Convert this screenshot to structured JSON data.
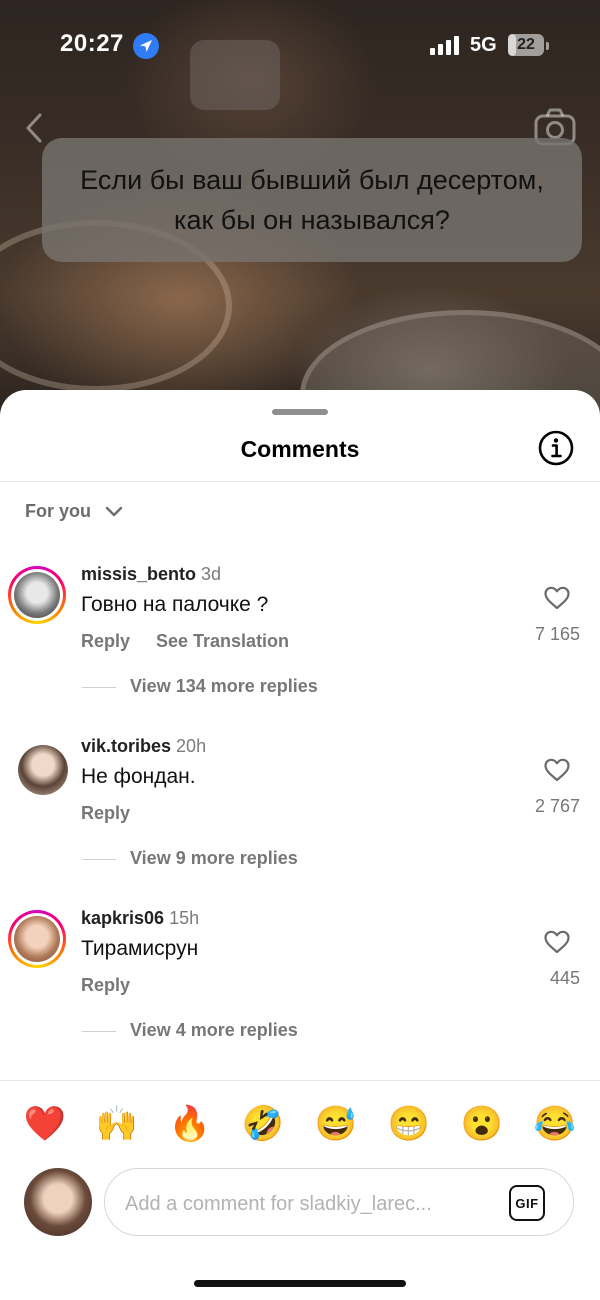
{
  "status_bar": {
    "time": "20:27",
    "network": "5G",
    "battery": "22",
    "battery_level": 0.22
  },
  "video": {
    "question": "Если бы ваш бывший был десертом, как бы он назывался?"
  },
  "sheet": {
    "title": "Comments",
    "sort_label": "For you"
  },
  "comments": [
    {
      "username": "missis_bento",
      "time": "3d",
      "text": "Говно на палочке ?",
      "reply_label": "Reply",
      "translate_label": "See Translation",
      "likes": "7 165",
      "view_replies": "View 134 more replies"
    },
    {
      "username": "vik.toribes",
      "time": "20h",
      "text": "Не фондан.",
      "reply_label": "Reply",
      "likes": "2 767",
      "view_replies": "View 9 more replies"
    },
    {
      "username": "kapkris06",
      "time": "15h",
      "text": "Тирамисрун",
      "reply_label": "Reply",
      "likes": "445",
      "view_replies": "View 4 more replies"
    }
  ],
  "emoji_bar": [
    "❤️",
    "🙌",
    "🔥",
    "🤣",
    "😅",
    "😁",
    "😮",
    "😂"
  ],
  "composer": {
    "placeholder": "Add a comment for sladkiy_larec...",
    "gif_label": "GIF"
  }
}
